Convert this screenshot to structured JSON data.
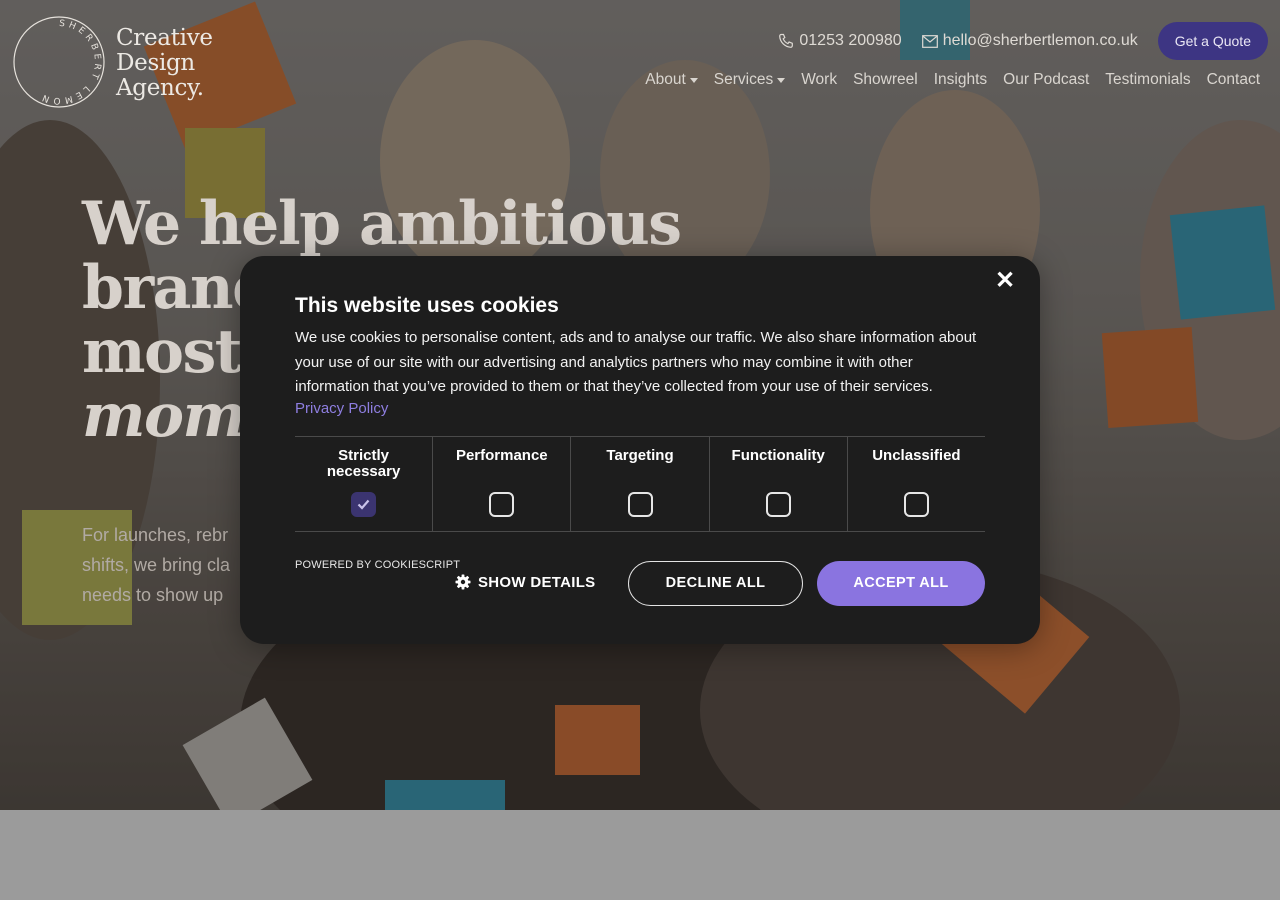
{
  "brand": {
    "logo_ring_text": "SHERBERT LEMON",
    "logo_lines": [
      "Creative",
      "Design",
      "Agency."
    ]
  },
  "header": {
    "phone": "01253 200980",
    "email": "hello@sherbertlemon.co.uk",
    "quote_label": "Get a Quote"
  },
  "nav": {
    "items": [
      {
        "label": "About",
        "dropdown": true
      },
      {
        "label": "Services",
        "dropdown": true
      },
      {
        "label": "Work",
        "dropdown": false
      },
      {
        "label": "Showreel",
        "dropdown": false
      },
      {
        "label": "Insights",
        "dropdown": false
      },
      {
        "label": "Our Podcast",
        "dropdown": false
      },
      {
        "label": "Testimonials",
        "dropdown": false
      },
      {
        "label": "Contact",
        "dropdown": false
      }
    ]
  },
  "hero": {
    "line1": "We help ambitious",
    "line2": "brand",
    "line3": "most s",
    "line4_italic": "momen",
    "sub_line1": "For launches, rebr",
    "sub_line2": "shifts, we bring cla",
    "sub_line3": "needs to show up"
  },
  "cookie": {
    "title": "This website uses cookies",
    "description": "We use cookies to personalise content, ads and to analyse our traffic. We also share information about your use of our site with our advertising and analytics partners who may combine it with other information that you’ve provided to them or that they’ve collected from your use of their services.",
    "privacy_label": "Privacy Policy",
    "close_label": "✕",
    "categories": [
      {
        "label": "Strictly necessary",
        "checked": true
      },
      {
        "label": "Performance",
        "checked": false
      },
      {
        "label": "Targeting",
        "checked": false
      },
      {
        "label": "Functionality",
        "checked": false
      },
      {
        "label": "Unclassified",
        "checked": false
      }
    ],
    "powered_by": "POWERED BY COOKIESCRIPT",
    "show_details": "SHOW DETAILS",
    "decline_label": "DECLINE ALL",
    "accept_label": "ACCEPT ALL"
  },
  "colors": {
    "accent": "#8a74e0",
    "quote_button": "#3d3583",
    "modal_bg": "#1d1d1d"
  }
}
